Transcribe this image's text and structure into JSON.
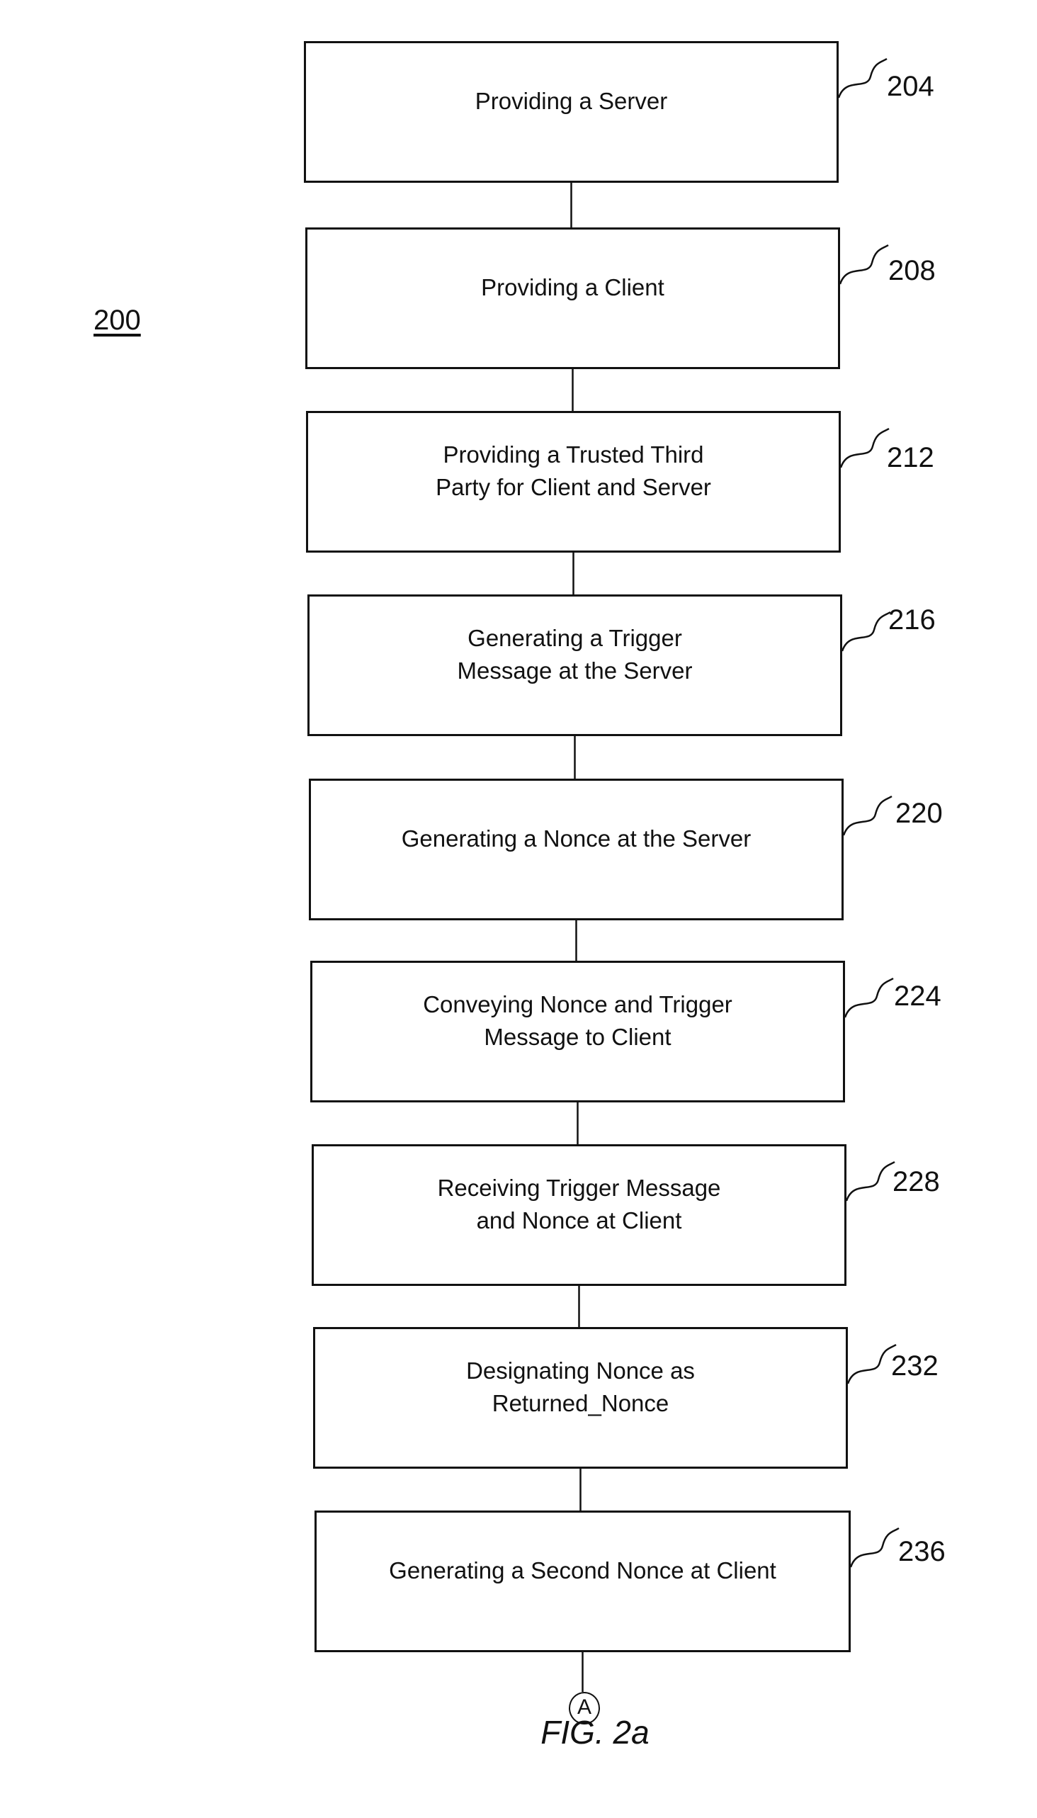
{
  "figure": {
    "number": "200",
    "title": "FIG. 2a",
    "connector_label": "A"
  },
  "steps": [
    {
      "ref": "204",
      "label": "Providing a Server"
    },
    {
      "ref": "208",
      "label": "Providing a Client"
    },
    {
      "ref": "212",
      "label": "Providing a Trusted Third\nParty for Client and Server"
    },
    {
      "ref": "216",
      "label": "Generating a Trigger\nMessage at the Server"
    },
    {
      "ref": "220",
      "label": "Generating a Nonce at the Server"
    },
    {
      "ref": "224",
      "label": "Conveying Nonce and Trigger\nMessage to Client"
    },
    {
      "ref": "228",
      "label": "Receiving Trigger Message\nand Nonce at Client"
    },
    {
      "ref": "232",
      "label": "Designating Nonce as\nReturned_Nonce"
    },
    {
      "ref": "236",
      "label": "Generating a Second Nonce at Client"
    }
  ]
}
